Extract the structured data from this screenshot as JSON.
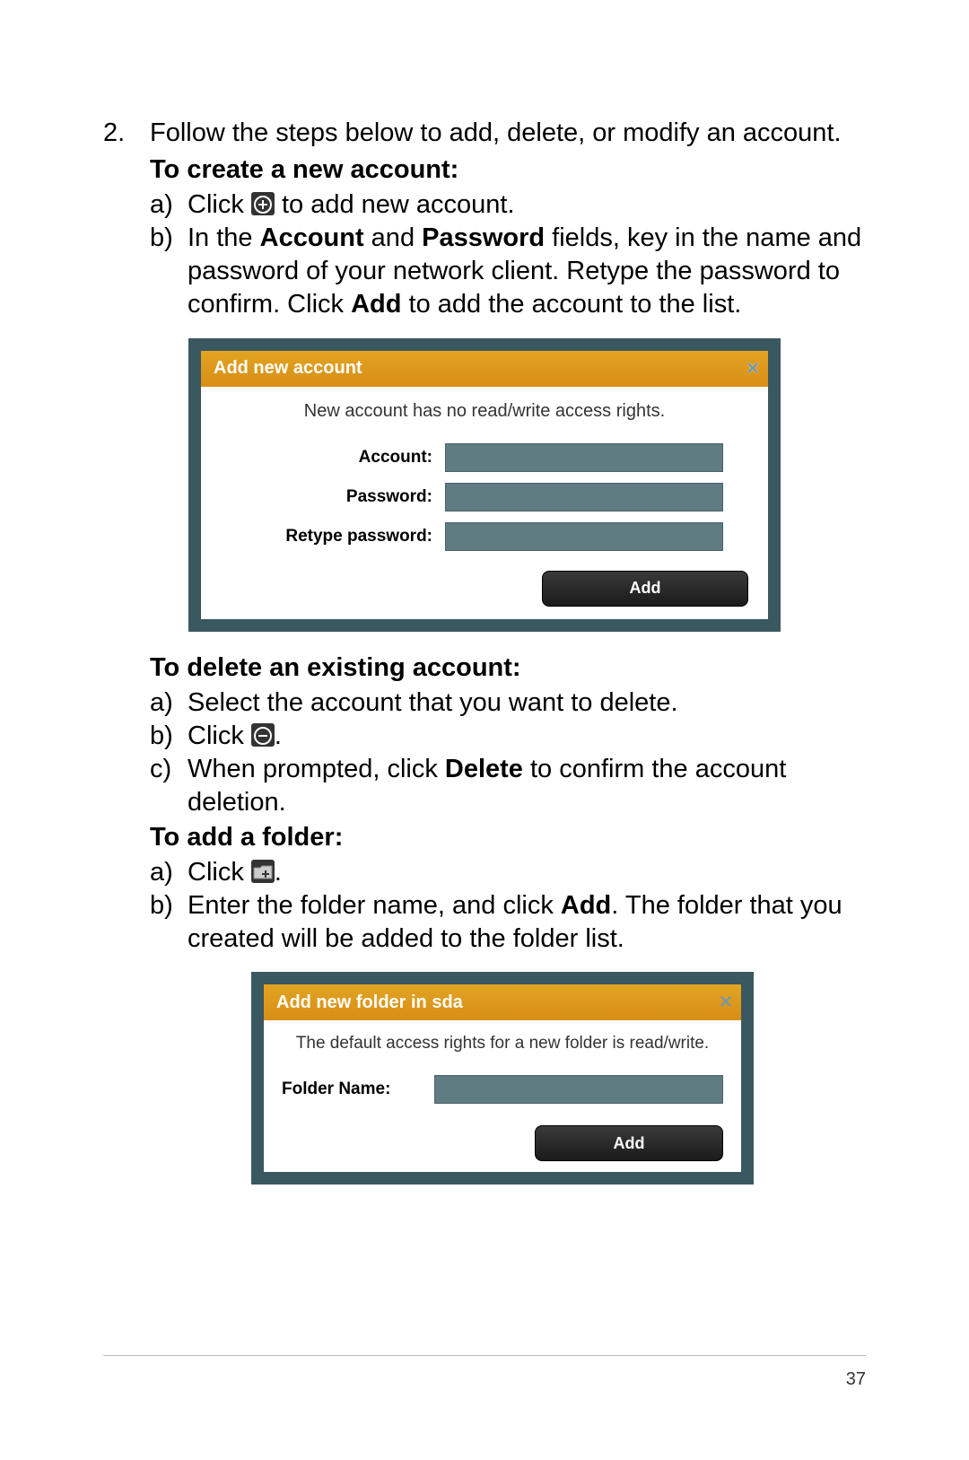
{
  "step2": {
    "num": "2.",
    "text": "Follow the steps below to add, delete, or modify an account."
  },
  "createHeading": "To create a new account:",
  "createA": {
    "letter": "a)",
    "pre": "Click ",
    "post": " to add new account."
  },
  "createB": {
    "letter": "b)",
    "p1": "In the ",
    "b1": "Account",
    "p2": " and ",
    "b2": "Password",
    "p3": " fields, key in the name and password of your network client. Retype the password to confirm. Click ",
    "b3": "Add",
    "p4": " to add the account to the list."
  },
  "dialog1": {
    "title": "Add new account",
    "message": "New account has no read/write access rights.",
    "accountLabel": "Account:",
    "passwordLabel": "Password:",
    "retypeLabel": "Retype password:",
    "addButton": "Add"
  },
  "deleteHeading": "To delete an existing account:",
  "deleteA": {
    "letter": "a)",
    "text": "Select the account that you want to delete."
  },
  "deleteB": {
    "letter": "b)",
    "pre": "Click ",
    "post": "."
  },
  "deleteC": {
    "letter": "c)",
    "p1": "When prompted, click ",
    "b1": "Delete",
    "p2": " to confirm the account deletion."
  },
  "folderHeading": "To add a folder:",
  "folderA": {
    "letter": "a)",
    "pre": "Click ",
    "post": "."
  },
  "folderB": {
    "letter": "b)",
    "p1": "Enter the folder name, and click ",
    "b1": "Add",
    "p2": ". The folder that you created will be added to the folder list."
  },
  "dialog2": {
    "titlePre": "Add new folder in ",
    "titleDisk": "sda",
    "message": "The default access rights for a new folder is read/write.",
    "folderLabel": "Folder Name:",
    "addButton": "Add"
  },
  "pageNumber": "37"
}
